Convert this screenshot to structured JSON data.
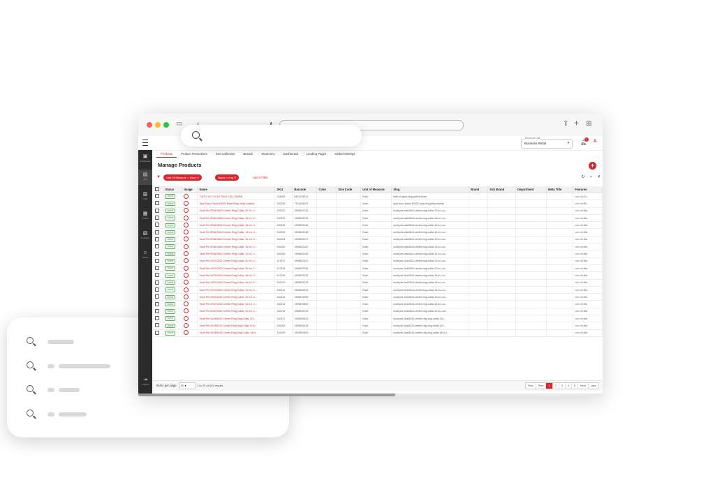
{
  "app": {
    "page_title": "Manage Products",
    "store_selector": {
      "label": "Business Unit",
      "value": "Business Retail"
    },
    "notification_count": "2"
  },
  "tabs": [
    {
      "label": "Products",
      "active": true
    },
    {
      "label": "Product Promotions"
    },
    {
      "label": "Seo Collection"
    },
    {
      "label": "Brands"
    },
    {
      "label": "Taxonomy"
    },
    {
      "label": "Dashboard"
    },
    {
      "label": "Landing Pages"
    },
    {
      "label": "Global Settings"
    }
  ],
  "sidebar": [
    {
      "label": "Dashboard",
      "icon": "dashboard-icon"
    },
    {
      "label": "PIM",
      "icon": "pim-icon"
    },
    {
      "label": "CMS",
      "icon": "cms-icon"
    },
    {
      "label": "Orders",
      "icon": "orders-icon"
    },
    {
      "label": "Inventory",
      "icon": "inventory-icon"
    },
    {
      "label": "Admin",
      "icon": "admin-icon"
    },
    {
      "label": "Logout",
      "icon": "logout-icon"
    }
  ],
  "filters": {
    "chips": [
      {
        "field": "Unit Of Measure",
        "op": "=",
        "value": "Each"
      },
      {
        "field": "Name",
        "op": "≈",
        "value": "ring"
      }
    ],
    "add_label": "Add A Filter"
  },
  "table": {
    "columns": [
      "Status",
      "Image",
      "Name",
      "SKU",
      "Barcode",
      "Color",
      "Size Code",
      "Unit of Measure",
      "Slug",
      "Brand",
      "Sub Brand",
      "Department",
      "Meta Title",
      "Features"
    ],
    "rows": [
      [
        "Active",
        "TUFFY ULT OCHT RING YELLOW/BK",
        "209383",
        "6301293511",
        "",
        "",
        "Each",
        "tuffy-ult-gear-ring-yellow-bone",
        "",
        "",
        "",
        "",
        "<ul><li>Co"
      ],
      [
        "Active",
        "Spot Duro-Fused 54032 Rope Ring Jerky Leather",
        "240035",
        "7751454527",
        "",
        "",
        "Each",
        "spot-duro-fused-54032-rope-ring-jerky-leather",
        "",
        "",
        "",
        "",
        "<ul><li>Ro"
      ],
      [
        "Active",
        "Scott Pet SRAK0820 Center Ring Collar, 20 in L C...",
        "240020",
        "1995822116",
        "",
        "",
        "Each",
        "scott-pet-srak0820-center-ring-collar-20-in-l-co...",
        "",
        "",
        "",
        "",
        "<ul><li>Ma"
      ],
      [
        "Active",
        "Scott Pet SRAK0818 Center Ring Collar, 18 in L C...",
        "240021",
        "1995822119",
        "",
        "",
        "Each",
        "scott-pet-srak0818-center-ring-collar-18-in-l-co...",
        "",
        "",
        "",
        "",
        "<ul><li>Ma"
      ],
      [
        "Active",
        "Scott Pet SRAK0816 Center Ring Collar, 16 in L C...",
        "240022",
        "1995822136",
        "",
        "",
        "Each",
        "scott-pet-srak0816-center-ring-collar-16-in-l-co...",
        "",
        "",
        "",
        "",
        "<ul><li>Ma"
      ],
      [
        "Active",
        "Scott Pet SRAK0814 Center Ring Collar, 14 in L C...",
        "240023",
        "1995822138",
        "",
        "",
        "Each",
        "scott-pet-srak0814-center-ring-collar-14-in-l-co...",
        "",
        "",
        "",
        "",
        "<ul><li>Ma"
      ],
      [
        "Active",
        "Scott Pet SRAK0810 Center Ring Collar, 10 in L C...",
        "240024",
        "1995822127",
        "",
        "",
        "Each",
        "scott-pet-srak0810-center-ring-collar-10-in-l-co...",
        "",
        "",
        "",
        "",
        "<ul><li>Ma"
      ],
      [
        "Active",
        "Scott Pet SRAK0815 Center Ring Collar, 15 in L C...",
        "240025",
        "1995822187",
        "",
        "",
        "Each",
        "scott-pet-srak0815-center-ring-collar-15-in-l-co...",
        "",
        "",
        "",
        "",
        "<ul><li>Ma"
      ],
      [
        "Active",
        "Scott Pet SRAK0812 Center Ring Collar, 12 in L C...",
        "240026",
        "1995822165",
        "",
        "",
        "Each",
        "scott-pet-srak0812-center-ring-collar-12-in-l-co...",
        "",
        "",
        "",
        "",
        "<ul><li>Ma"
      ],
      [
        "Active",
        "Scott Pet 1RCK0522 Center Ring Collar, 22 in L C...",
        "247917",
        "1995822307",
        "",
        "",
        "Each",
        "scott-pet-1rck0522-center-ring-collar-22-in-l-co...",
        "",
        "",
        "",
        "",
        "<ul><li>Ma"
      ],
      [
        "Active",
        "Scott Pet 1RCK0520 Center Ring Collar, 20 in L C...",
        "247918",
        "1995822295",
        "",
        "",
        "Each",
        "scott-pet-1rck0520-center-ring-collar-20-in-l-co...",
        "",
        "",
        "",
        "",
        "<ul><li>Ma"
      ],
      [
        "Active",
        "Scott Pet 1RCK0518 Center Ring Collar, 18 in L C...",
        "247919",
        "1995822232",
        "",
        "",
        "Each",
        "scott-pet-1rck0518-center-ring-collar-18-in-l-co...",
        "",
        "",
        "",
        "",
        "<ul><li>Ma"
      ],
      [
        "Active",
        "Scott Pet 1RCK0516 Center Ring Collar, 16 in L C...",
        "240010",
        "1995822318",
        "",
        "",
        "Each",
        "scott-pet-1rck0516-center-ring-collar-16-in-l-co...",
        "",
        "",
        "",
        "",
        "<ul><li>Ma"
      ],
      [
        "Active",
        "Scott Pet 1RCK0514 Center Ring Collar, 14 in L C...",
        "240011",
        "1995822431",
        "",
        "",
        "Each",
        "scott-pet-1rck0514-center-ring-collar-14-in-l-co...",
        "",
        "",
        "",
        "",
        "<ul><li>Ma"
      ],
      [
        "Active",
        "Scott Pet 1RCK0510 Center Ring Collar, 10 in L C...",
        "240012",
        "1995819969",
        "",
        "",
        "Each",
        "scott-pet-1rck0510-center-ring-collar-10-in-l-co...",
        "",
        "",
        "",
        "",
        "<ul><li>Ma"
      ],
      [
        "Active",
        "Scott Pet 1RCK0515 Center Ring Collar, 15 in L C...",
        "240013",
        "1995819800",
        "",
        "",
        "Each",
        "scott-pet-1rck0515-center-ring-collar-15-in-l-co...",
        "",
        "",
        "",
        "",
        "<ul><li>Ma"
      ],
      [
        "Active",
        "Scott Pet 1RCK0512 Center Ring Collar, 12 in L C...",
        "240014",
        "1995819725",
        "",
        "",
        "Each",
        "scott-pet-1rck0512-center-ring-collar-12-in-l-col...",
        "",
        "",
        "",
        "",
        "<ul><li>Ma"
      ],
      [
        "Active",
        "Scott Pet 1KAR5320 Center Ring Dog Collar, 20 i...",
        "240017",
        "1995892623",
        "",
        "",
        "Each",
        "scott-pet-1kar5320-center-ring-dog-collar-20-i...",
        "",
        "",
        "",
        "",
        "<ul><li>Ma"
      ],
      [
        "Active",
        "Scott Pet 1KAR5223 Center Ring Dog Collar 20 in...",
        "240026",
        "1995892618",
        "",
        "",
        "Each",
        "scott-pet-1kar5223-center-ring-dog-collar-20-i...",
        "",
        "",
        "",
        "",
        "<ul><li>Ma"
      ],
      [
        "Active",
        "Scott Pet 1KAR5018 Center Ring Dog Collar, 18 in...",
        "240025",
        "1995892609",
        "",
        "",
        "Each",
        "scott-pet-1kar5018-center-ring-dog-collar-18-in-l-...",
        "",
        "",
        "",
        "",
        "<ul><li>Ma"
      ]
    ]
  },
  "footer": {
    "items_per_page_label": "Items per page",
    "items_per_page_value": "20",
    "results_text": "1 to 20 of 643 results",
    "pager": [
      "First",
      "Prev",
      "1",
      "2",
      "3",
      "4",
      "5",
      "Next",
      "Last"
    ],
    "current_page": "1"
  }
}
